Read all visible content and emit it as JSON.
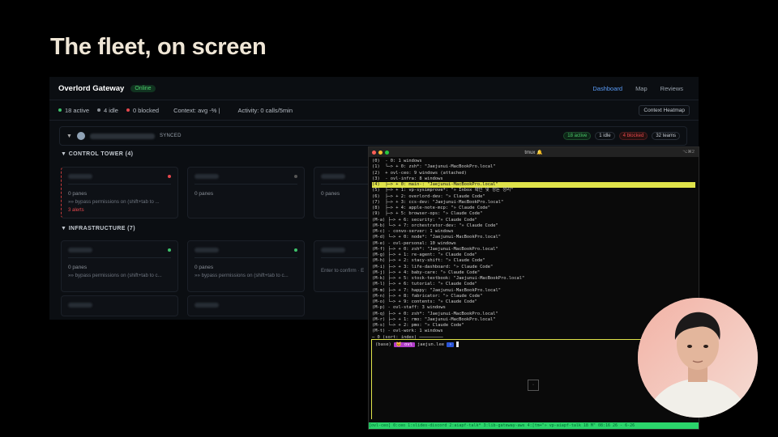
{
  "slide": {
    "title": "The fleet, on screen"
  },
  "dashboard": {
    "app_title": "Overlord Gateway",
    "status_badge": "Online",
    "nav": [
      "Dashboard",
      "Map",
      "Reviews"
    ],
    "stats": {
      "active": "18 active",
      "idle": "4 idle",
      "blocked": "0 blocked",
      "context": "Context: avg -% |",
      "activity": "Activity: 0 calls/5min"
    },
    "heatmap_button": "Context Heatmap",
    "group": {
      "synced": "SYNCED",
      "badges": [
        "18 active",
        "1 idle",
        "4 blocked",
        "32 teams"
      ]
    },
    "sections": {
      "control_tower": "CONTROL TOWER (4)",
      "infrastructure": "INFRASTRUCTURE (7)"
    },
    "cards": {
      "c1": {
        "panes": "0 panes",
        "bypass": "»» bypass permissions on (shift+tab to ...",
        "alerts": "3 alerts"
      },
      "c2": {
        "panes": "0 panes"
      },
      "c3": {
        "panes": "0 panes"
      },
      "i1": {
        "panes": "0 panes",
        "bypass": "»» bypass permissions on (shift+tab to c..."
      },
      "i2": {
        "panes": "0 panes",
        "bypass": "»» bypass permissions on (shift+tab to c..."
      },
      "i3": {
        "bypass": "Enter to confirm · E"
      }
    },
    "colors": {
      "accent": "#5a9cf8",
      "green": "#3ec26b",
      "red": "#e5484d"
    }
  },
  "terminal": {
    "title": "tmux 🔔",
    "key_hint": "⌥⌘2",
    "tree_lines": [
      "(0)  - 0: 1 windows",
      "(1)  └─> + 0: zsh*: \"Jaejunui-MacBookPro.local\"",
      "(2)  + ovl-ceo: 9 windows (attached)",
      "(3)  - ovl-infra: 8 windows",
      "(4)  ├─> + 0: main-: \"Jaejunui-MacBookPro.local\"",
      "(5)  ├─> + 1: vp-sysimprove*: \"» Inbox 확인 및 정돈 정리\"",
      "(6)  ├─> + 2: overlord-dev: \"» Claude Code\"",
      "(7)  ├─> + 3: ccs-dev: \"Jaejunui-MacBookPro.local\"",
      "(8)  ├─> + 4: apple-note-mcp: \"» Claude Code\"",
      "(9)  ├─> + 5: browser-ops: \"» Claude Code\"",
      "(M-a) ├─> + 6: security: \"» Claude Code\"",
      "(M-b) └─> + 7: orchestrator-dev: \"» Claude Code\"",
      "(M-c) - convo-server: 1 windows",
      "(M-d) └─> + 0: node*: \"Jaejunui-MacBookPro.local\"",
      "(M-e) - ovl-personal: 10 windows",
      "(M-f) ├─> + 0: zsh*: \"Jaejunui-MacBookPro.local\"",
      "(M-g) ├─> + 1: re-agent: \"» Claude Code\"",
      "(M-h) ├─> + 2: stacy-shift: \"» Claude Code\"",
      "(M-i) ├─> + 3: life-dashboard: \"» Claude Code\"",
      "(M-j) ├─> + 4: baby-care: \"» Claude Code\"",
      "(M-k) ├─> + 5: stock-textbook: \"Jaejunui-MacBookPro.local\"",
      "(M-l) ├─> + 6: tutorial: \"» Claude Code\"",
      "(M-m) ├─> + 7: happy: \"Jaejunui-MacBookPro.local\"",
      "(M-n) ├─> + 8: fabricator: \"» Claude Code\"",
      "(M-o) └─> + 9: contents: \"» Claude Code\"",
      "(M-p) - ovl-staff: 3 windows",
      "(M-q) ├─> + 0: zsh*: \"Jaejunui-MacBookPro.local\"",
      "(M-r) ├─> + 1: rmo: \"Jaejunui-MacBookPro.local\"",
      "(M-s) └─> + 2: pmo: \"» Claude Code\"",
      "(M-t) - ovl-work: 1 windows"
    ],
    "separator": "─ 0 (sort: index) ─────────",
    "prompt": {
      "env": "(base)",
      "host": "🐱 ovl",
      "user": "jaejun.lee",
      "arrow": "›"
    },
    "status_line": "[ovl-ceo] 0:ceo  1:slides-discord  2:aiapf-talk*  3:lib-gateway-aws  4:[tm+\"» vp-aiapf-talk 18 M\" 08:16 26 - 6-26"
  }
}
